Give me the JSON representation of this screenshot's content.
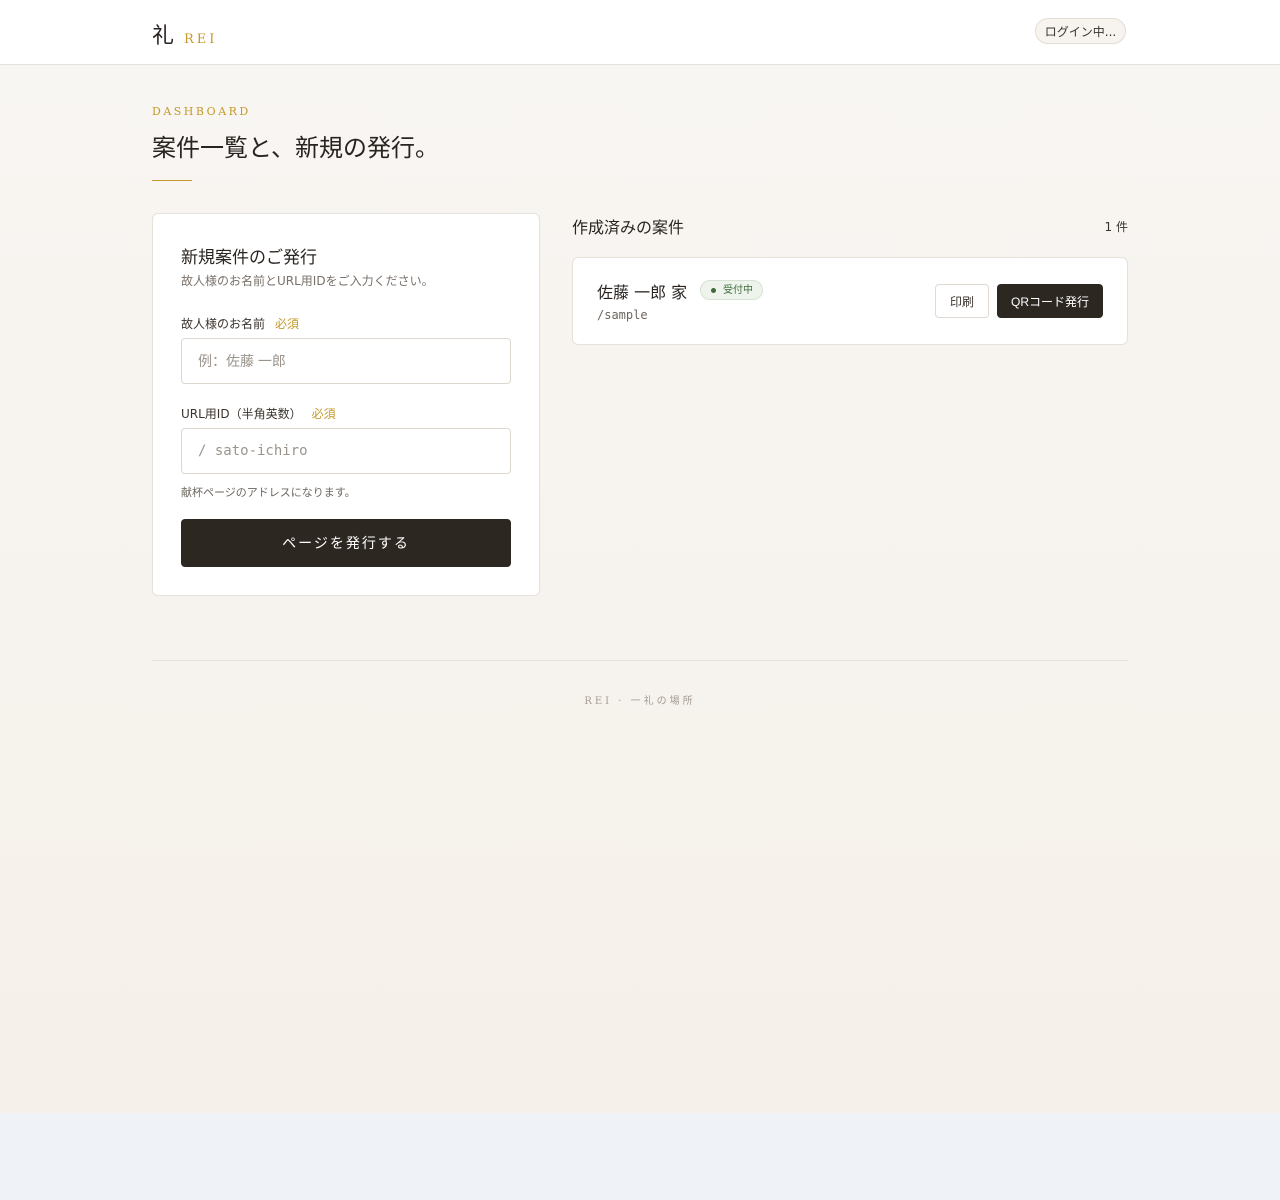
{
  "header": {
    "brand_kanji": "礼",
    "brand_latin": "REI",
    "login_status": "ログイン中..."
  },
  "page": {
    "eyebrow": "DASHBOARD",
    "title": "案件一覧と、新規の発行。"
  },
  "form": {
    "title": "新規案件のご発行",
    "subtitle": "故人様のお名前とURL用IDをご入力ください。",
    "name_label": "故人様のお名前",
    "name_required": "必須",
    "name_placeholder": "例：佐藤 一郎",
    "id_label": "URL用ID（半角英数）",
    "id_required": "必須",
    "id_placeholder": "/ sato-ichiro",
    "id_help": "献杯ページのアドレスになります。",
    "submit_label": "ページを発行する"
  },
  "cases": {
    "heading": "作成済みの案件",
    "count": "1 件",
    "items": [
      {
        "name": "佐藤 一郎 家",
        "status": "受付中",
        "slug": "/sample",
        "print_label": "印刷",
        "qr_label": "QRコード発行"
      }
    ]
  },
  "footer": {
    "text": "REI · 一礼の場所"
  },
  "colors": {
    "accent_gold": "#c49a2c",
    "primary_dark": "#2d2722",
    "status_green": "#3f6b3c"
  }
}
